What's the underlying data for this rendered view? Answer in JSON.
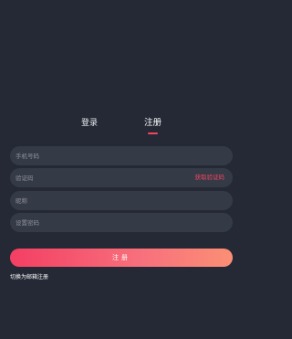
{
  "tabs": {
    "login": "登录",
    "register": "注册",
    "active": "register"
  },
  "form": {
    "phone_placeholder": "手机号码",
    "code_placeholder": "验证码",
    "get_code_label": "获取验证码",
    "nickname_placeholder": "昵称",
    "password_placeholder": "设置密码",
    "submit_label": "注册",
    "switch_label": "切换为邮箱注册"
  },
  "colors": {
    "background": "#242935",
    "field": "#353a47",
    "accent": "#f2465f",
    "button_gradient_start": "#f33f63",
    "button_gradient_end": "#fb8f75"
  }
}
